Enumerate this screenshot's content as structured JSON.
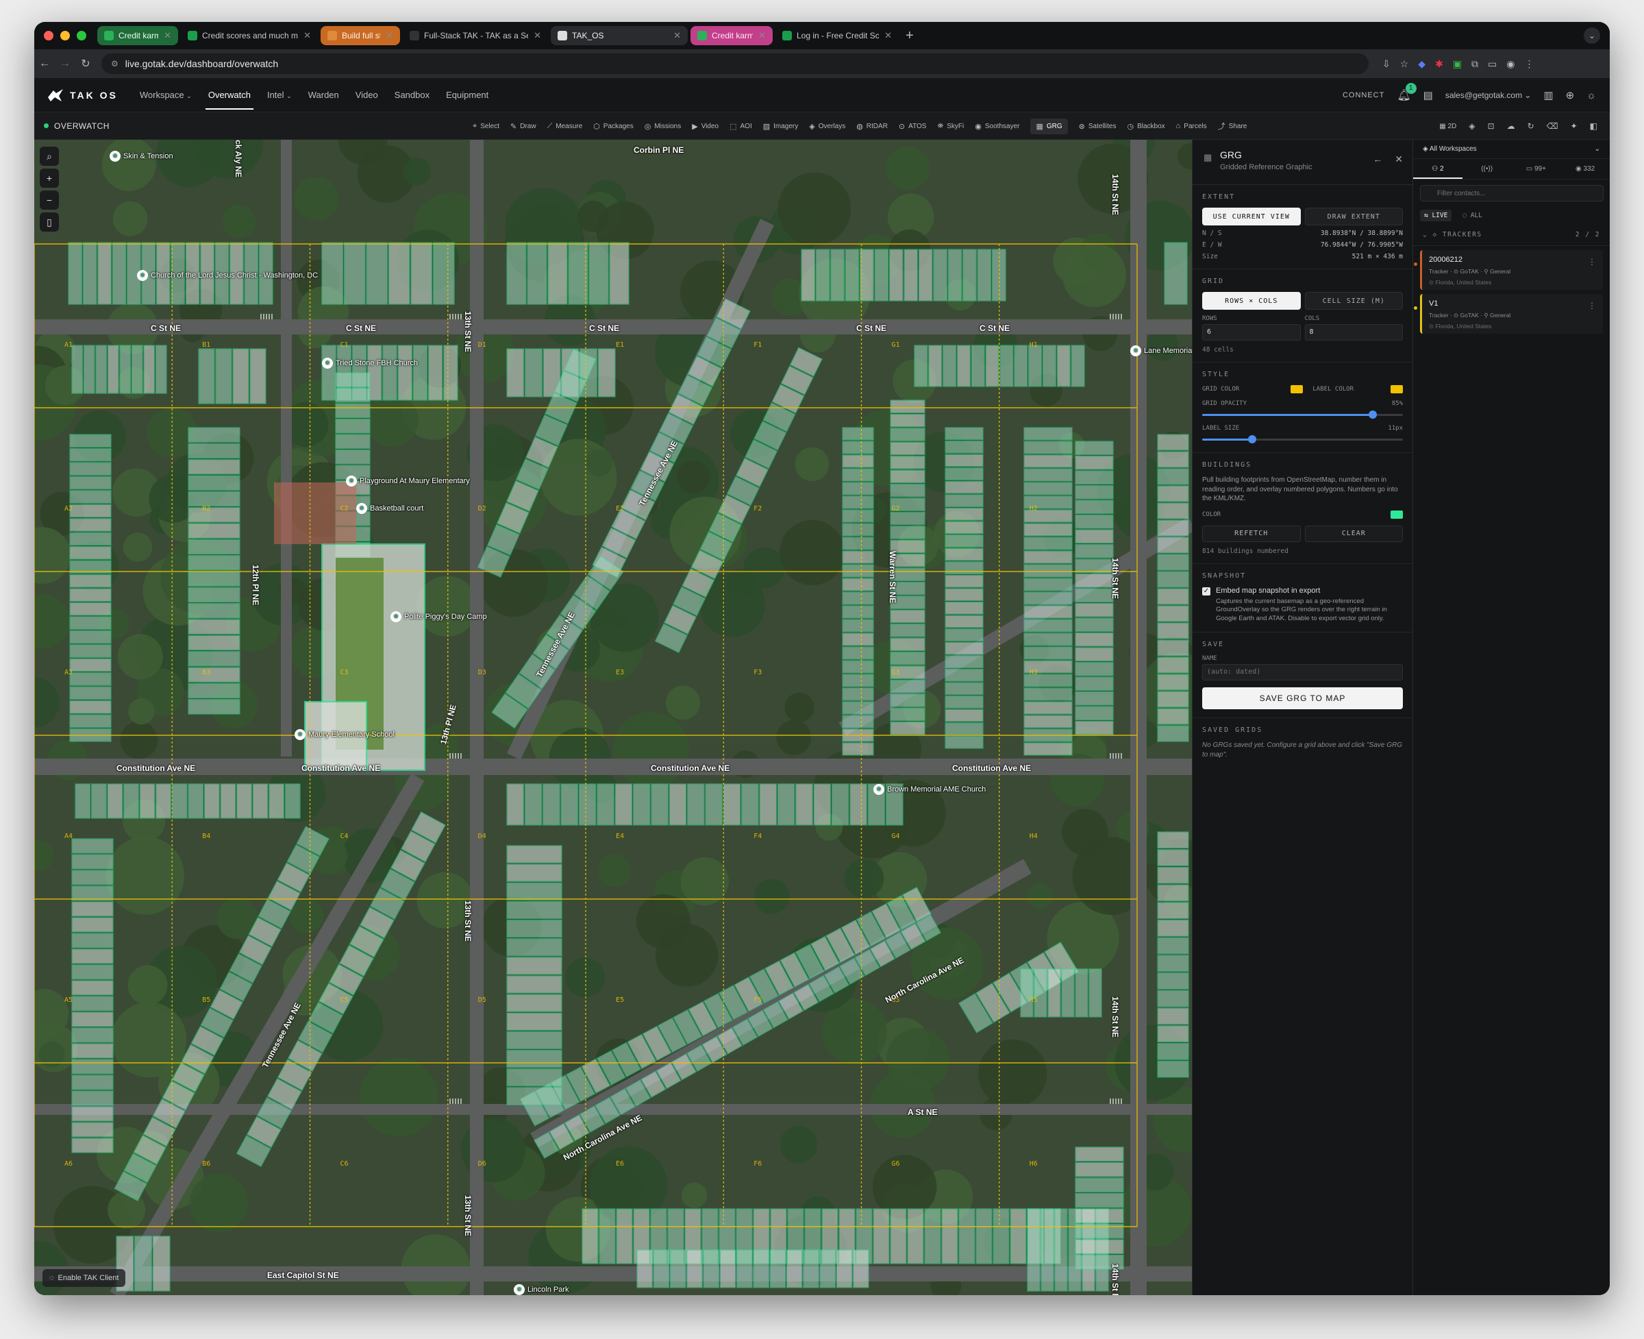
{
  "browser": {
    "tabs": [
      {
        "title": "Credit karma daily",
        "group": "g",
        "fav": "#2ab15a"
      },
      {
        "title": "Credit scores and much more",
        "group": "",
        "fav": "#1b9e4b"
      },
      {
        "title": "Build full stack TAK",
        "group": "o",
        "fav": "#e08a3c"
      },
      {
        "title": "Full-Stack TAK - TAK as a Se",
        "group": "",
        "fav": "#333"
      },
      {
        "title": "TAK_OS",
        "group": "active",
        "fav": "#dddddd"
      },
      {
        "title": "Credit karma daily",
        "group": "p",
        "fav": "#2ab15a"
      },
      {
        "title": "Log in - Free Credit Score & F",
        "group": "",
        "fav": "#1b9e4b"
      }
    ],
    "url": "live.gotak.dev/dashboard/overwatch"
  },
  "app": {
    "brand": "TAK OS",
    "nav": [
      {
        "label": "Workspace",
        "has_menu": true,
        "active": false
      },
      {
        "label": "Overwatch",
        "has_menu": false,
        "active": true
      },
      {
        "label": "Intel",
        "has_menu": true,
        "active": false
      },
      {
        "label": "Warden",
        "has_menu": false,
        "active": false
      },
      {
        "label": "Video",
        "has_menu": false,
        "active": false
      },
      {
        "label": "Sandbox",
        "has_menu": false,
        "active": false
      },
      {
        "label": "Equipment",
        "has_menu": false,
        "active": false
      }
    ],
    "connect": "CONNECT",
    "notif_count": "1",
    "account": "sales@getgotak.com"
  },
  "toolbar": {
    "mode": "OVERWATCH",
    "tools": [
      {
        "label": "Select",
        "icon": "cursor-icon"
      },
      {
        "label": "Draw",
        "icon": "pencil-icon"
      },
      {
        "label": "Measure",
        "icon": "ruler-icon"
      },
      {
        "label": "Packages",
        "icon": "package-icon"
      },
      {
        "label": "Missions",
        "icon": "target-icon"
      },
      {
        "label": "Video",
        "icon": "video-icon"
      },
      {
        "label": "AOI",
        "icon": "aoi-icon"
      },
      {
        "label": "Imagery",
        "icon": "image-icon"
      },
      {
        "label": "Overlays",
        "icon": "layers-icon"
      },
      {
        "label": "RIDAR",
        "icon": "radar-icon"
      },
      {
        "label": "ATOS",
        "icon": "pin-icon"
      },
      {
        "label": "SkyFi",
        "icon": "satellite-icon"
      },
      {
        "label": "Soothsayer",
        "icon": "eye-icon"
      },
      {
        "label": "GRG",
        "icon": "grid-icon",
        "active": true
      },
      {
        "label": "Satellites",
        "icon": "orbit-icon"
      },
      {
        "label": "Blackbox",
        "icon": "clock-icon"
      },
      {
        "label": "Parcels",
        "icon": "parcel-icon"
      },
      {
        "label": "Share",
        "icon": "share-icon"
      }
    ],
    "view_mode": "2D"
  },
  "map": {
    "streets": [
      {
        "text": "Corbin Pl NE"
      },
      {
        "text": "C St NE"
      },
      {
        "text": "C St NE"
      },
      {
        "text": "C St NE"
      },
      {
        "text": "C St NE"
      },
      {
        "text": "C St NE"
      },
      {
        "text": "Constitution Ave NE"
      },
      {
        "text": "Constitution Ave NE"
      },
      {
        "text": "Constitution Ave NE"
      },
      {
        "text": "Constitution Ave NE"
      },
      {
        "text": "A St NE"
      },
      {
        "text": "East Capitol St NE"
      },
      {
        "text": "Tennessee Ave NE"
      },
      {
        "text": "Tennessee Ave NE"
      },
      {
        "text": "Tennessee Ave NE"
      },
      {
        "text": "North Carolina Ave NE"
      },
      {
        "text": "North Carolina Ave NE"
      },
      {
        "text": "12th Pl NE"
      },
      {
        "text": "13th St NE"
      },
      {
        "text": "13th St NE"
      },
      {
        "text": "13th St NE"
      },
      {
        "text": "Warren St NE"
      },
      {
        "text": "14th St NE"
      },
      {
        "text": "14th St NE"
      },
      {
        "text": "14th St NE"
      },
      {
        "text": "14th St NE"
      },
      {
        "text": "13th Pl NE"
      },
      {
        "text": "ck Aly NE"
      }
    ],
    "pois": [
      {
        "text": "Skin & Tension"
      },
      {
        "text": "Church of the Lord Jesus Christ - Washington, DC"
      },
      {
        "text": "Tried Stone FBH Church"
      },
      {
        "text": "Playground At Maury Elementary"
      },
      {
        "text": "Basketball court"
      },
      {
        "text": "Polite Piggy's Day Camp"
      },
      {
        "text": "Maury Elementary School"
      },
      {
        "text": "Brown Memorial AME Church"
      },
      {
        "text": "Lane Memorial CME Church"
      },
      {
        "text": "Lincoln Park"
      }
    ],
    "cells_x": [
      "A",
      "B",
      "C",
      "D",
      "E",
      "F",
      "G"
    ],
    "enable_client": "Enable TAK Client"
  },
  "grg": {
    "title": "GRG",
    "subtitle": "Gridded Reference Graphic",
    "extent": {
      "title": "EXTENT",
      "use_current": "USE CURRENT VIEW",
      "draw": "DRAW EXTENT",
      "ns_label": "N / S",
      "ns_value": "38.8938°N / 38.8899°N",
      "ew_label": "E / W",
      "ew_value": "76.9844°W / 76.9905°W",
      "size_label": "Size",
      "size_value": "521 m × 436 m"
    },
    "grid": {
      "title": "GRID",
      "rows_cols": "ROWS × COLS",
      "cell_size": "CELL SIZE (M)",
      "rows_label": "ROWS",
      "rows_value": "6",
      "cols_label": "COLS",
      "cols_value": "8",
      "cells": "48 cells"
    },
    "style": {
      "title": "STYLE",
      "grid_color_label": "GRID COLOR",
      "grid_color": "#f2c200",
      "label_color_label": "LABEL COLOR",
      "label_color": "#f2c200",
      "opacity_label": "GRID OPACITY",
      "opacity_value": "85%",
      "opacity_fraction": 0.85,
      "label_size_label": "LABEL SIZE",
      "label_size_value": "11px",
      "label_size_fraction": 0.25
    },
    "buildings": {
      "title": "BUILDINGS",
      "description": "Pull building footprints from OpenStreetMap, number them in reading order, and overlay numbered polygons. Numbers go into the KML/KMZ.",
      "color_label": "COLOR",
      "color": "#2ee89a",
      "refetch": "REFETCH",
      "clear": "CLEAR",
      "count": "814 buildings numbered"
    },
    "snapshot": {
      "title": "SNAPSHOT",
      "checkbox": "Embed map snapshot in export",
      "description": "Captures the current basemap as a geo-referenced GroundOverlay so the GRG renders over the right terrain in Google Earth and ATAK. Disable to export vector grid only."
    },
    "save": {
      "title": "SAVE",
      "name_label": "NAME",
      "placeholder": "(auto: dated)",
      "button": "SAVE GRG TO MAP"
    },
    "saved": {
      "title": "SAVED GRIDS",
      "empty": "No GRGs saved yet. Configure a grid above and click \"Save GRG to map\"."
    }
  },
  "sidebar": {
    "workspace": "All Workspaces",
    "stats": [
      {
        "label": "2",
        "icon": "users-icon"
      },
      {
        "label": "",
        "icon": "signal-icon"
      },
      {
        "label": "99+",
        "icon": "chat-icon"
      },
      {
        "label": "332",
        "icon": "marker-icon"
      }
    ],
    "filter_placeholder": "Filter contacts...",
    "live": "LIVE",
    "all": "ALL",
    "trackers_title": "TRACKERS",
    "trackers_count": "2 / 2",
    "trackers": [
      {
        "name": "20006212",
        "type": "Tracker",
        "org": "GoTAK",
        "group": "General",
        "location": "Florida, United States",
        "accent": "#c8612b"
      },
      {
        "name": "V1",
        "type": "Tracker",
        "org": "GoTAK",
        "group": "General",
        "location": "Florida, United States",
        "accent": "#e3c21a"
      }
    ]
  }
}
